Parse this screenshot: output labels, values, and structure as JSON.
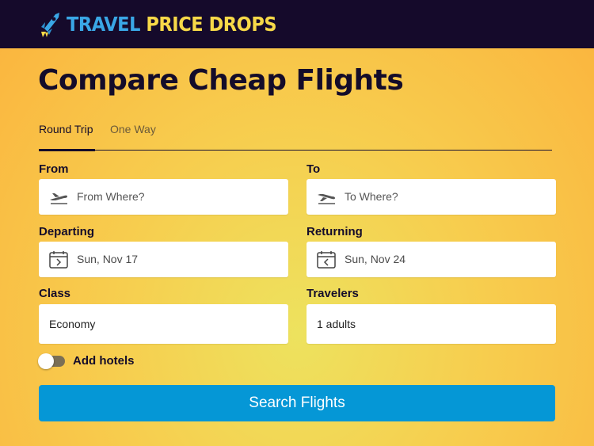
{
  "brand": {
    "part1": "TRAVEL",
    "part2": "PRICE DROPS",
    "icon": "rocket-icon"
  },
  "page_title": "Compare Cheap Flights",
  "tabs": [
    {
      "label": "Round Trip",
      "active": true
    },
    {
      "label": "One Way",
      "active": false
    }
  ],
  "form": {
    "from": {
      "label": "From",
      "placeholder": "From Where?",
      "icon": "plane-takeoff-icon"
    },
    "to": {
      "label": "To",
      "placeholder": "To Where?",
      "icon": "plane-landing-icon"
    },
    "departing": {
      "label": "Departing",
      "value": "Sun, Nov 17",
      "icon": "calendar-next-icon"
    },
    "returning": {
      "label": "Returning",
      "value": "Sun, Nov 24",
      "icon": "calendar-prev-icon"
    },
    "class": {
      "label": "Class",
      "value": "Economy"
    },
    "travelers": {
      "label": "Travelers",
      "value": "1 adults"
    },
    "add_hotels": {
      "label": "Add hotels",
      "checked": false
    }
  },
  "search_button": "Search Flights",
  "colors": {
    "topbar": "#150a2b",
    "brand_blue": "#3aa7e6",
    "brand_yellow": "#f7d948",
    "button": "#0597d6",
    "text_dark": "#140c2a"
  }
}
